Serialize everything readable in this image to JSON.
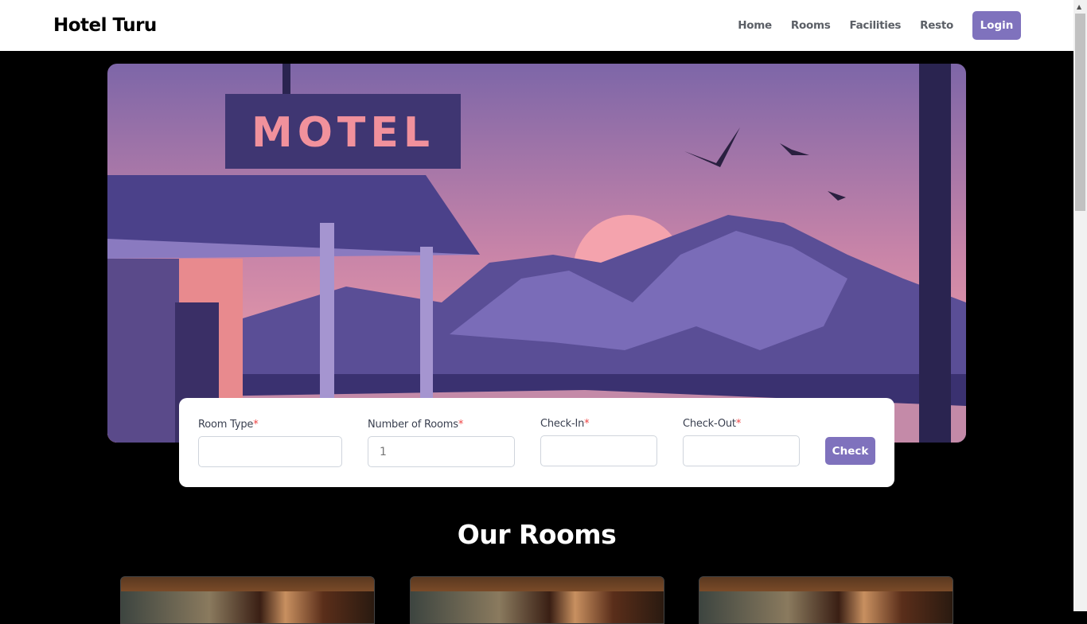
{
  "nav": {
    "brand": "Hotel Turu",
    "links": [
      "Home",
      "Rooms",
      "Facilities",
      "Resto"
    ],
    "login": "Login"
  },
  "hero": {
    "sign": "MOTEL"
  },
  "form": {
    "fields": [
      {
        "label": "Room Type",
        "required": "*",
        "value": "",
        "placeholder": ""
      },
      {
        "label": "Number of Rooms",
        "required": "*",
        "value": "",
        "placeholder": "1"
      },
      {
        "label": "Check-In",
        "required": "*",
        "value": "",
        "placeholder": ""
      },
      {
        "label": "Check-Out",
        "required": "*",
        "value": "",
        "placeholder": ""
      }
    ],
    "submit": "Check"
  },
  "rooms": {
    "title": "Our Rooms"
  },
  "colors": {
    "accent": "#7f72bd",
    "required": "#ef4444"
  }
}
